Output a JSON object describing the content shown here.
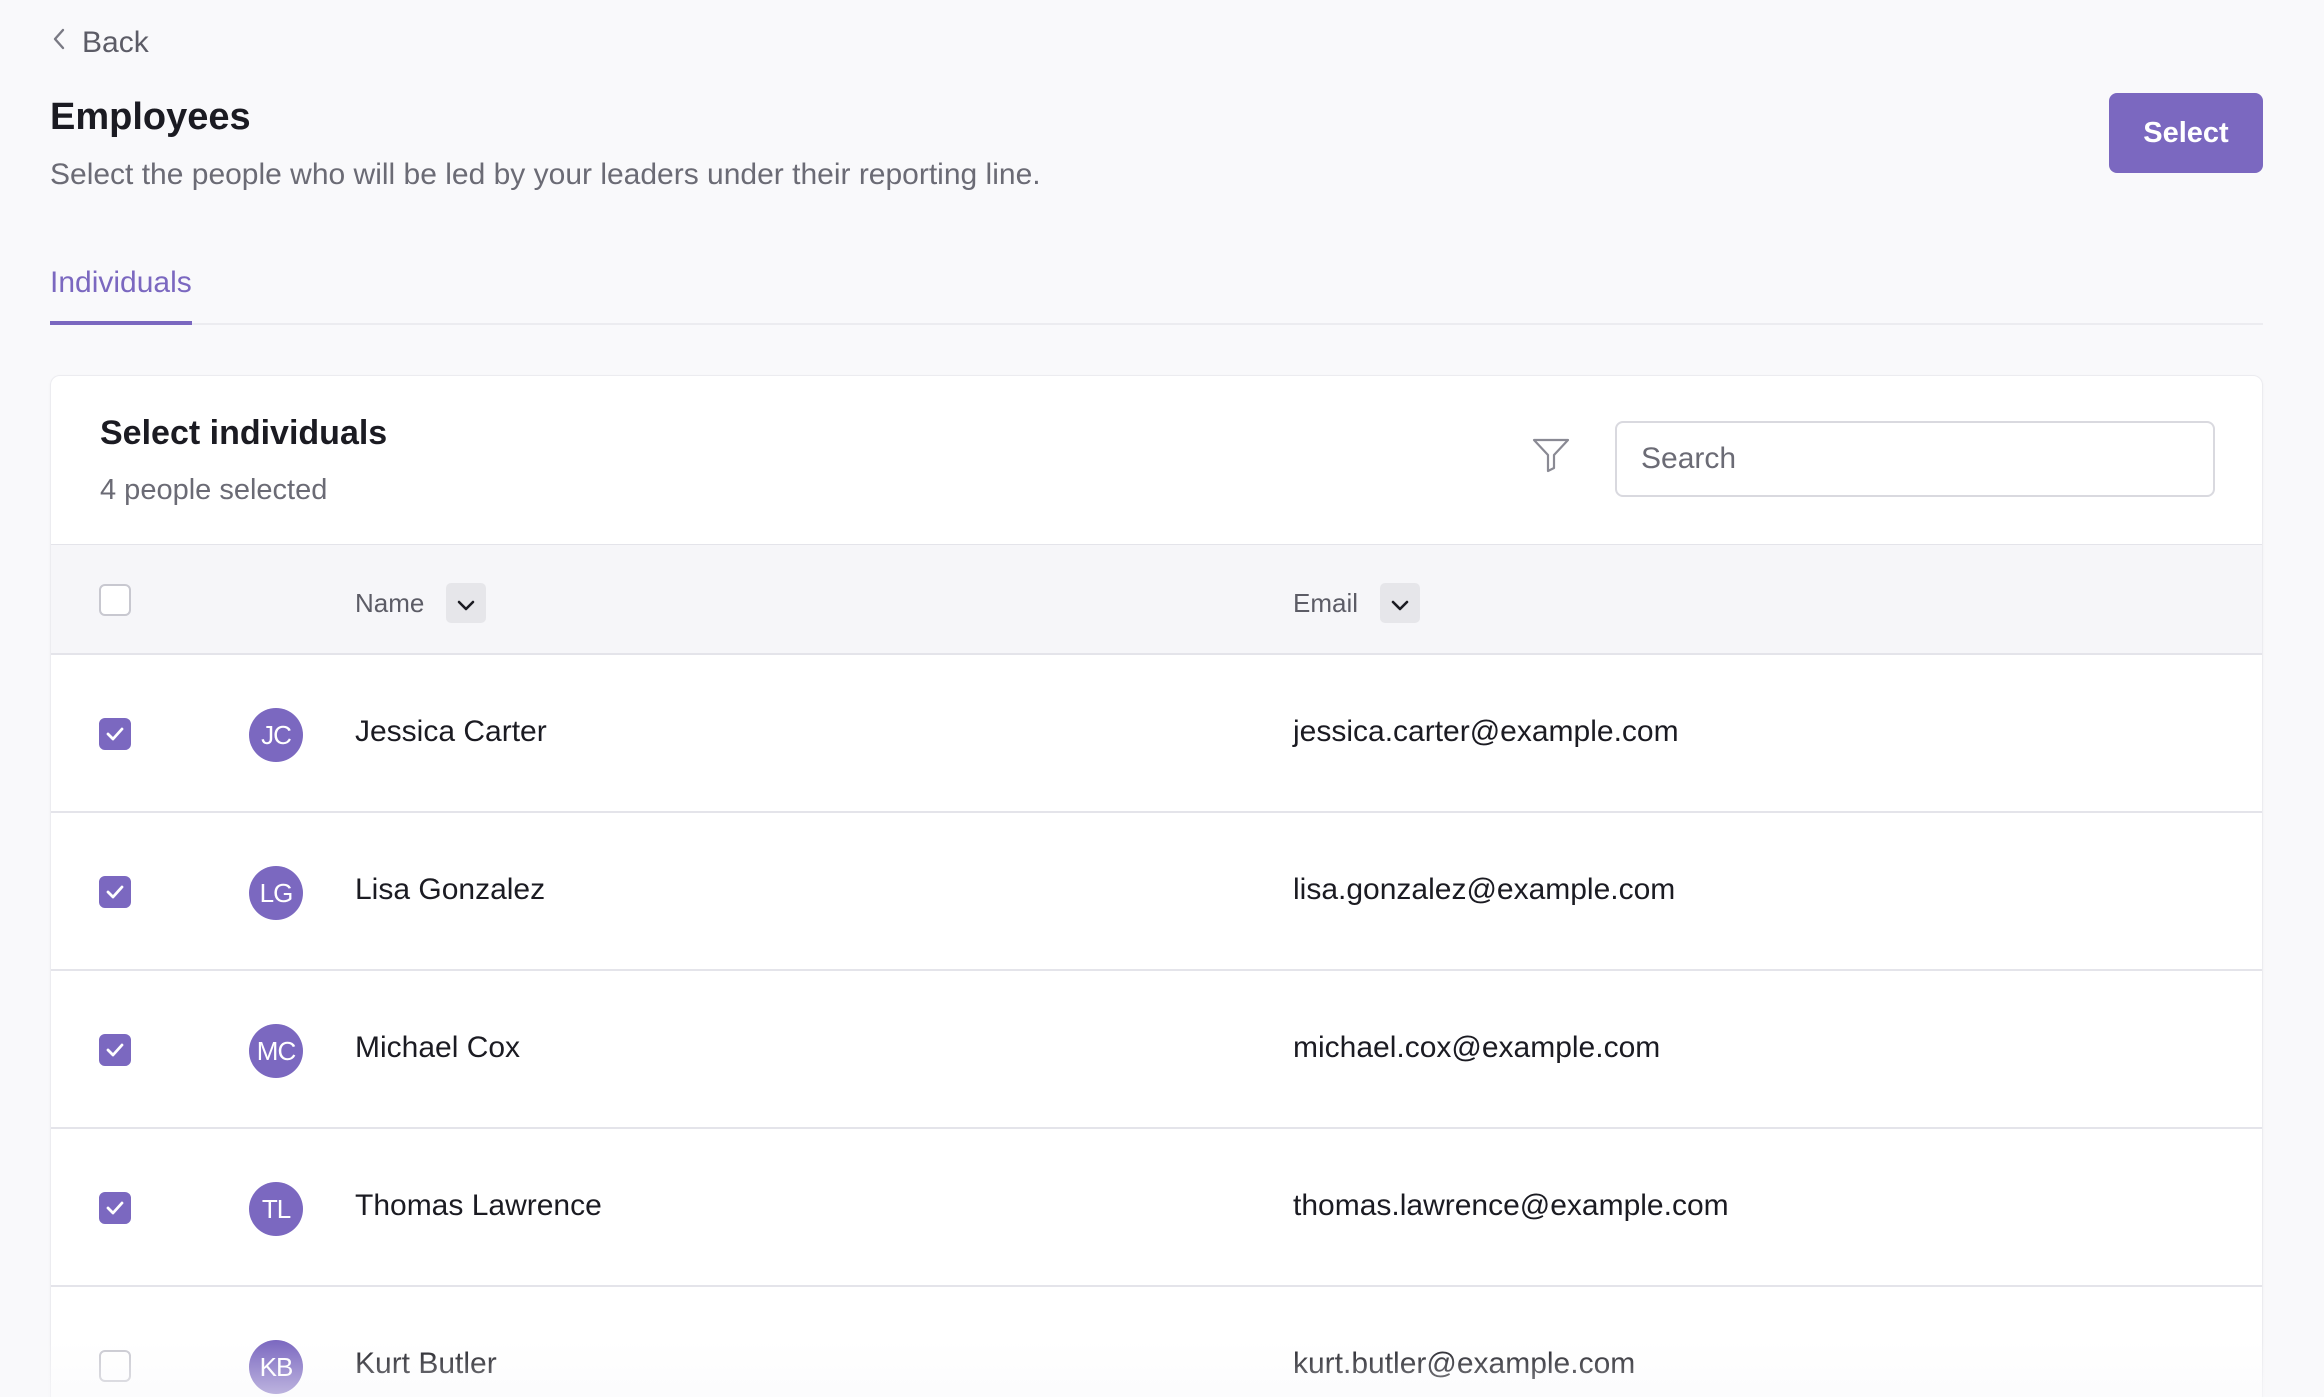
{
  "nav": {
    "back_label": "Back"
  },
  "header": {
    "title": "Employees",
    "subtitle": "Select the people who will be led by your leaders under their reporting line.",
    "select_button_label": "Select"
  },
  "tabs": [
    {
      "label": "Individuals",
      "active": true
    }
  ],
  "panel": {
    "title": "Select individuals",
    "selected_count_text": "4 people selected",
    "search_placeholder": "Search",
    "search_value": ""
  },
  "table": {
    "columns": {
      "name": "Name",
      "email": "Email"
    },
    "select_all_checked": false,
    "rows": [
      {
        "initials": "JC",
        "name": "Jessica Carter",
        "email": "jessica.carter@example.com",
        "checked": true
      },
      {
        "initials": "LG",
        "name": "Lisa Gonzalez",
        "email": "lisa.gonzalez@example.com",
        "checked": true
      },
      {
        "initials": "MC",
        "name": "Michael Cox",
        "email": "michael.cox@example.com",
        "checked": true
      },
      {
        "initials": "TL",
        "name": "Thomas Lawrence",
        "email": "thomas.lawrence@example.com",
        "checked": true
      },
      {
        "initials": "KB",
        "name": "Kurt Butler",
        "email": "kurt.butler@example.com",
        "checked": false
      }
    ]
  },
  "icons": {
    "back": "chevron-left-icon",
    "filter": "filter-funnel-icon",
    "sort": "chevron-down-icon",
    "check": "checkmark-icon"
  },
  "colors": {
    "accent": "#7b68c0",
    "background": "#f9f9fb",
    "card": "#ffffff",
    "text_primary": "#1b1b22",
    "text_secondary": "#6b6b75"
  }
}
